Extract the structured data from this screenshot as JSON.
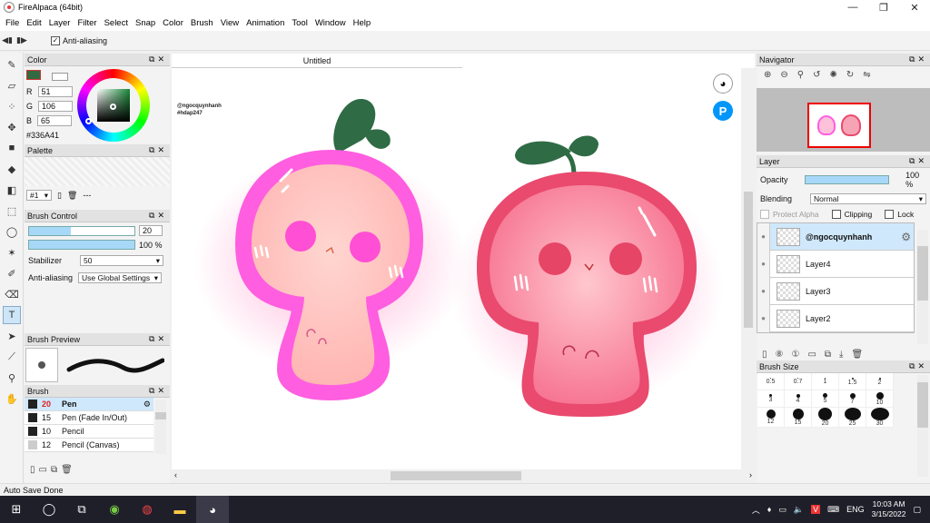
{
  "window": {
    "title": "FireAlpaca (64bit)",
    "min": "—",
    "max": "❐",
    "close": "✕"
  },
  "menu": [
    "File",
    "Edit",
    "Layer",
    "Filter",
    "Select",
    "Snap",
    "Color",
    "Brush",
    "View",
    "Animation",
    "Tool",
    "Window",
    "Help"
  ],
  "tool_options": {
    "antialias_label": "Anti-aliasing",
    "antialias_checked": "✓"
  },
  "color_panel": {
    "title": "Color",
    "r_label": "R",
    "r": "51",
    "g_label": "G",
    "g": "106",
    "b_label": "B",
    "b": "65",
    "hex": "#336A41",
    "current_color": "#336A41"
  },
  "palette_panel": {
    "title": "Palette",
    "set_label": "#1",
    "dash": "---"
  },
  "brush_control": {
    "title": "Brush Control",
    "size": "20",
    "opacity": "100 %",
    "size_fraction": 0.4,
    "opacity_fraction": 1.0,
    "stabilizer_label": "Stabilizer",
    "stabilizer": "50",
    "antialias_label": "Anti-aliasing",
    "antialias": "Use Global Settings"
  },
  "brush_preview": {
    "title": "Brush Preview"
  },
  "brush_list": {
    "title": "Brush",
    "items": [
      {
        "size": "20",
        "name": "Pen"
      },
      {
        "size": "15",
        "name": "Pen (Fade In/Out)"
      },
      {
        "size": "10",
        "name": "Pencil"
      },
      {
        "size": "12",
        "name": "Pencil (Canvas)"
      }
    ]
  },
  "document": {
    "tab": "Untitled",
    "watermark_line1": "@ngocquynhanh",
    "watermark_line2": "#hdap247"
  },
  "navigator": {
    "title": "Navigator"
  },
  "layer_panel": {
    "title": "Layer",
    "opacity_label": "Opacity",
    "opacity": "100 %",
    "blending_label": "Blending",
    "blending": "Normal",
    "protect_alpha": "Protect Alpha",
    "clipping": "Clipping",
    "lock": "Lock",
    "layers": [
      {
        "name": "@ngocquynhanh"
      },
      {
        "name": "Layer4"
      },
      {
        "name": "Layer3"
      },
      {
        "name": "Layer2"
      }
    ]
  },
  "brush_size": {
    "title": "Brush Size",
    "sizes": [
      "0.5",
      "0.7",
      "1",
      "1.5",
      "2",
      "3",
      "4",
      "5",
      "7",
      "10",
      "12",
      "15",
      "20",
      "25",
      "30"
    ]
  },
  "status": {
    "text": "Auto Save Done"
  },
  "taskbar": {
    "time": "10:03 AM",
    "date": "3/15/2022",
    "lang": "ENG"
  }
}
